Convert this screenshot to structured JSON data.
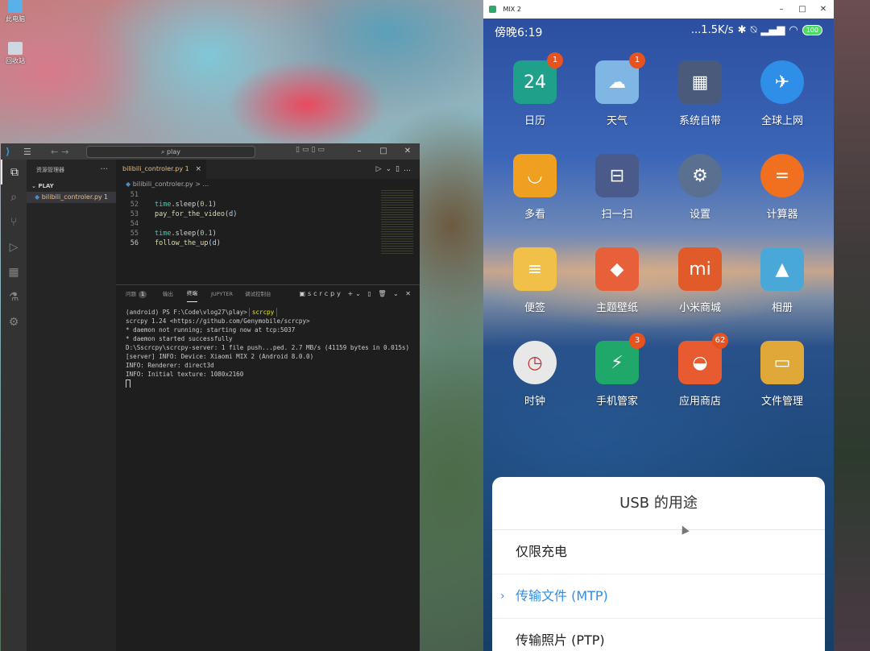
{
  "desktop": {
    "icons": [
      {
        "label": "此电脑",
        "icon": "computer-icon"
      },
      {
        "label": "回收站",
        "icon": "recycle-bin-icon"
      }
    ]
  },
  "vscode": {
    "search_text": "play",
    "explorer_title": "资源管理器",
    "more": "···",
    "folder": "PLAY",
    "file": {
      "name": "bilibili_controler.py",
      "badge": "1"
    },
    "tab": {
      "label": "bilibili_controler.py 1",
      "close": "×"
    },
    "breadcrumb": "bilibili_controler.py > ...",
    "code_lines": [
      {
        "num": "51",
        "text": ""
      },
      {
        "num": "52",
        "mod": "time",
        "call": ".sleep(",
        "arg": "0.1",
        "end": ")"
      },
      {
        "num": "53",
        "fn": "pay_for_the_video",
        "open": "(",
        "var": "d",
        "close": ")"
      },
      {
        "num": "54",
        "text": ""
      },
      {
        "num": "55",
        "mod": "time",
        "call": ".sleep(",
        "arg": "0.1",
        "end": ")"
      },
      {
        "num": "56",
        "fn": "follow_the_up",
        "open": "(",
        "var": "d",
        "close": ")"
      }
    ],
    "panel_tabs": {
      "problems": "问题",
      "problems_count": "1",
      "output": "输出",
      "terminal": "终端",
      "jupyter": "JUPYTER",
      "debug_console": "调试控制台",
      "shell": "scrcpy"
    },
    "terminal": {
      "prompt": "(android) PS F:\\Code\\vlog27\\play>",
      "command": "scrcpy",
      "lines": [
        "scrcpy 1.24 <https://github.com/Genymobile/scrcpy>",
        "* daemon not running; starting now at tcp:5037",
        "* daemon started successfully",
        "D:\\Sscrcpy\\scrcpy-server: 1 file push...ped. 2.7 MB/s (41159 bytes in 0.015s)",
        "[server] INFO: Device: Xiaomi MIX 2 (Android 8.0.0)",
        "INFO: Renderer: direct3d",
        "INFO: Initial texture: 1080x2160"
      ]
    }
  },
  "phone": {
    "window_title": "MIX 2",
    "status": {
      "time": "傍晚6:19",
      "speed": "...1.5K/s",
      "battery": "100"
    },
    "apps": [
      {
        "label": "日历",
        "glyph": "24",
        "badge": "1",
        "color": "#1fa08a",
        "icon": "calendar-icon"
      },
      {
        "label": "天气",
        "glyph": "☁",
        "badge": "1",
        "color": "#7fb6e4",
        "icon": "weather-icon"
      },
      {
        "label": "系统自带",
        "glyph": "▦",
        "badge": "",
        "color": "#4a5a7a",
        "icon": "system-folder-icon"
      },
      {
        "label": "全球上网",
        "glyph": "✈",
        "badge": "",
        "color": "#2f8ee8",
        "icon": "global-internet-icon"
      },
      {
        "label": "多看",
        "glyph": "◡",
        "badge": "",
        "color": "#f0a020",
        "icon": "duokan-icon"
      },
      {
        "label": "扫一扫",
        "glyph": "⊟",
        "badge": "",
        "color": "#4a5a8a",
        "icon": "scanner-icon"
      },
      {
        "label": "设置",
        "glyph": "⚙",
        "badge": "",
        "color": "#5a7090",
        "icon": "settings-icon"
      },
      {
        "label": "计算器",
        "glyph": "=",
        "badge": "",
        "color": "#f07020",
        "icon": "calculator-icon"
      },
      {
        "label": "便签",
        "glyph": "≡",
        "badge": "",
        "color": "#f0c048",
        "icon": "notes-icon"
      },
      {
        "label": "主题壁纸",
        "glyph": "◆",
        "badge": "",
        "color": "#e8603a",
        "icon": "themes-icon"
      },
      {
        "label": "小米商城",
        "glyph": "mi",
        "badge": "",
        "color": "#e05a2a",
        "icon": "mi-store-icon"
      },
      {
        "label": "相册",
        "glyph": "▲",
        "badge": "",
        "color": "#4aa8d8",
        "icon": "gallery-icon"
      },
      {
        "label": "时钟",
        "glyph": "◷",
        "badge": "",
        "color": "#e8e8e8",
        "icon": "clock-icon"
      },
      {
        "label": "手机管家",
        "glyph": "⚡",
        "badge": "3",
        "color": "#1fa86a",
        "icon": "security-icon"
      },
      {
        "label": "应用商店",
        "glyph": "◒",
        "badge": "62",
        "color": "#e85a30",
        "icon": "app-store-icon"
      },
      {
        "label": "文件管理",
        "glyph": "▭",
        "badge": "",
        "color": "#e0a838",
        "icon": "file-manager-icon"
      }
    ],
    "usb_dialog": {
      "title": "USB 的用途",
      "options": [
        {
          "label": "仅限充电",
          "selected": false
        },
        {
          "label": "传输文件 (MTP)",
          "selected": true
        },
        {
          "label": "传输照片 (PTP)",
          "selected": false
        }
      ]
    }
  }
}
